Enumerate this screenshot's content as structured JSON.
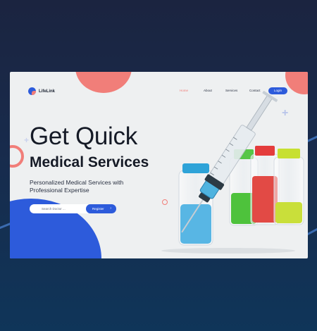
{
  "brand": {
    "name": "LifeLink",
    "logo_icon": "heart-pulse-icon"
  },
  "nav": {
    "items": [
      {
        "label": "Home",
        "active": true
      },
      {
        "label": "About",
        "active": false
      },
      {
        "label": "Services",
        "active": false
      },
      {
        "label": "Contact",
        "active": false
      }
    ],
    "login_label": "Login"
  },
  "hero": {
    "title_line1": "Get Quick",
    "title_line2": "Medical Services",
    "subtitle": "Personalized Medical Services with Professional Expertise",
    "search_placeholder": "Search Doctor ...",
    "register_label": "Register",
    "register_icon": "chevron-right-icon"
  },
  "colors": {
    "accent_blue": "#2d5bdb",
    "accent_coral": "#f17e79",
    "page_background": "#eef0f1",
    "outer_background": "#1b2440"
  }
}
